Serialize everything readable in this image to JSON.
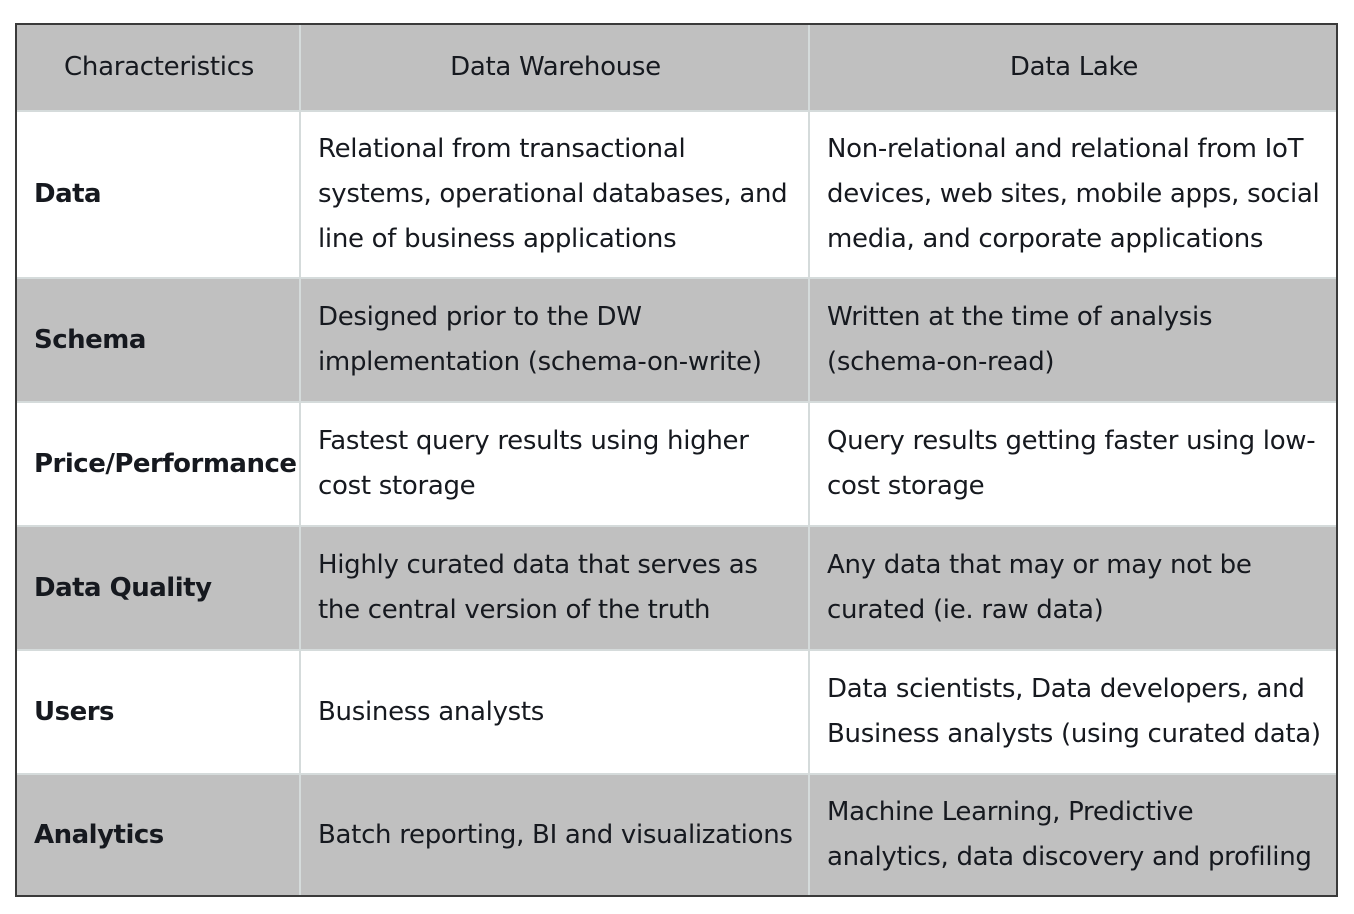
{
  "table": {
    "headers": [
      "Characteristics",
      "Data Warehouse",
      "Data Lake"
    ],
    "rows": [
      {
        "label": "Data",
        "warehouse": "Relational from transactional systems, operational databases, and line of business applications",
        "lake": "Non-relational and relational from IoT devices, web sites, mobile apps, social media, and corporate applications"
      },
      {
        "label": "Schema",
        "warehouse": "Designed prior to the DW implementation (schema-on-write)",
        "lake": "Written at the time of analysis (schema-on-read)"
      },
      {
        "label": "Price/Performance",
        "warehouse": "Fastest query results using higher cost storage",
        "lake": "Query results getting faster using low-cost storage"
      },
      {
        "label": "Data Quality",
        "warehouse": "Highly curated data that serves as the central version of the truth",
        "lake": "Any data that may or may not be curated (ie. raw data)"
      },
      {
        "label": "Users",
        "warehouse": "Business analysts",
        "lake": "Data scientists, Data developers, and Business analysts (using curated data)"
      },
      {
        "label": "Analytics",
        "warehouse": "Batch reporting, BI and visualizations",
        "lake": "Machine Learning, Predictive analytics, data discovery and profiling"
      }
    ]
  },
  "colors": {
    "header_bg": "#c0c0c0",
    "shaded_row_bg": "#c0c0c0",
    "plain_row_bg": "#ffffff",
    "border": "#3a3a3a",
    "cell_divider": "#d5dbdb",
    "text": "#16191f"
  }
}
